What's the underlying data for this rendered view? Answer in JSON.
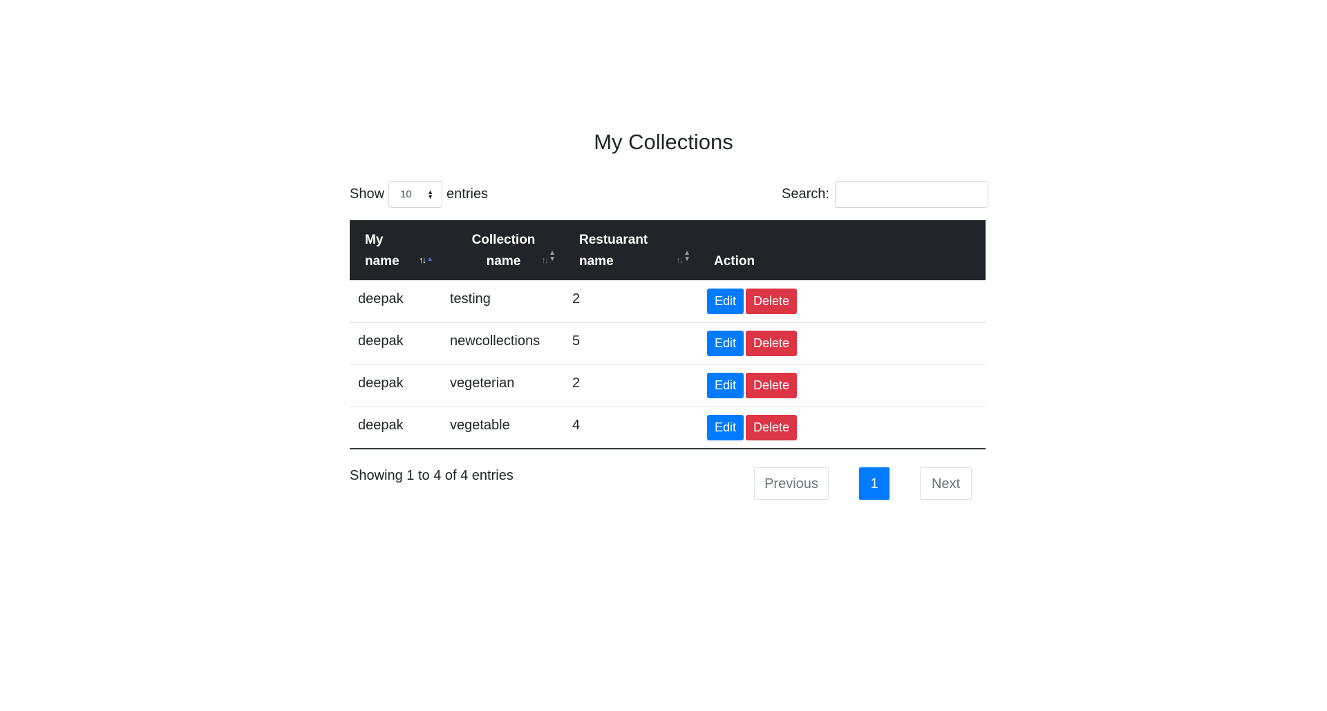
{
  "page": {
    "title": "My Collections"
  },
  "controls": {
    "show_label": "Show",
    "entries_label": "entries",
    "page_length": "10",
    "search_label": "Search:",
    "search_value": ""
  },
  "table": {
    "headers": [
      {
        "line1": "My",
        "line2": "name"
      },
      {
        "line1": "Collection",
        "line2": "name"
      },
      {
        "line1": "Restuarant",
        "line2": "name"
      },
      {
        "line1": "",
        "line2": "Action"
      }
    ],
    "rows": [
      {
        "my_name": "deepak",
        "collection_name": "testing",
        "restaurant": "2"
      },
      {
        "my_name": "deepak",
        "collection_name": "newcollections",
        "restaurant": "5"
      },
      {
        "my_name": "deepak",
        "collection_name": "vegeterian",
        "restaurant": "2"
      },
      {
        "my_name": "deepak",
        "collection_name": "vegetable",
        "restaurant": "4"
      }
    ],
    "edit_label": "Edit",
    "delete_label": "Delete"
  },
  "footer": {
    "info": "Showing 1 to 4 of 4 entries",
    "previous": "Previous",
    "current_page": "1",
    "next": "Next"
  },
  "colors": {
    "header_bg": "#212529",
    "edit": "#007bff",
    "delete": "#dc3545",
    "page_active": "#007bff"
  }
}
